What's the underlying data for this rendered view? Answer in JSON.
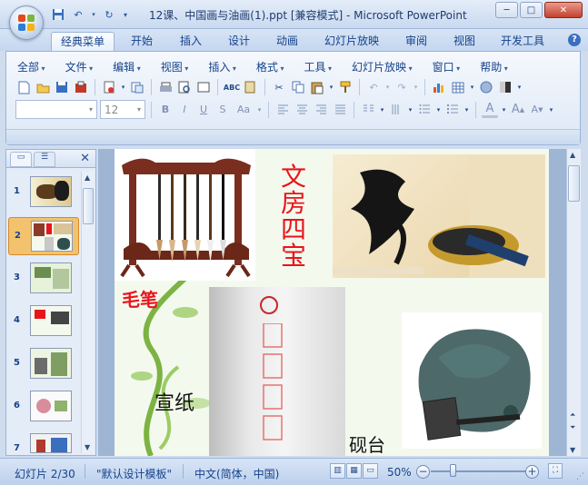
{
  "window": {
    "title": "12课、中国画与油画(1).ppt [兼容模式] - Microsoft PowerPoint",
    "controls": {
      "minimize": "─",
      "maximize": "□",
      "close": "✕"
    }
  },
  "quick_access": [
    "save-icon",
    "undo-icon",
    "redo-icon",
    "customize-icon"
  ],
  "tabs": [
    {
      "label": "经典菜单",
      "active": true
    },
    {
      "label": "开始"
    },
    {
      "label": "插入"
    },
    {
      "label": "设计"
    },
    {
      "label": "动画"
    },
    {
      "label": "幻灯片放映"
    },
    {
      "label": "审阅"
    },
    {
      "label": "视图"
    },
    {
      "label": "开发工具"
    }
  ],
  "help_label": "?",
  "classic_menu": [
    "全部",
    "文件",
    "编辑",
    "视图",
    "插入",
    "格式",
    "工具",
    "幻灯片放映",
    "窗口",
    "帮助"
  ],
  "toolbar": {
    "font_name_value": "",
    "font_size_value": "12",
    "format_buttons": {
      "bold": "B",
      "italic": "I",
      "underline": "U",
      "strike": "S",
      "case": "Aa"
    }
  },
  "slide_panel": {
    "tab_slides": "▭",
    "tab_outline": "☰",
    "close": "✕",
    "slides": [
      {
        "num": "1"
      },
      {
        "num": "2",
        "selected": true
      },
      {
        "num": "3"
      },
      {
        "num": "4"
      },
      {
        "num": "5"
      },
      {
        "num": "6"
      },
      {
        "num": "7"
      }
    ]
  },
  "slide": {
    "title": "文房四宝",
    "labels": {
      "brush": "毛笔",
      "paper": "宣纸",
      "inkstone": "砚台"
    },
    "colors": {
      "red_text": "#e8151b",
      "black_text": "#111111"
    }
  },
  "status": {
    "slide_info": "幻灯片 2/30",
    "theme": "\"默认设计模板\"",
    "language": "中文(简体，中国)",
    "zoom": "50%",
    "zoom_level_pct": 50
  }
}
